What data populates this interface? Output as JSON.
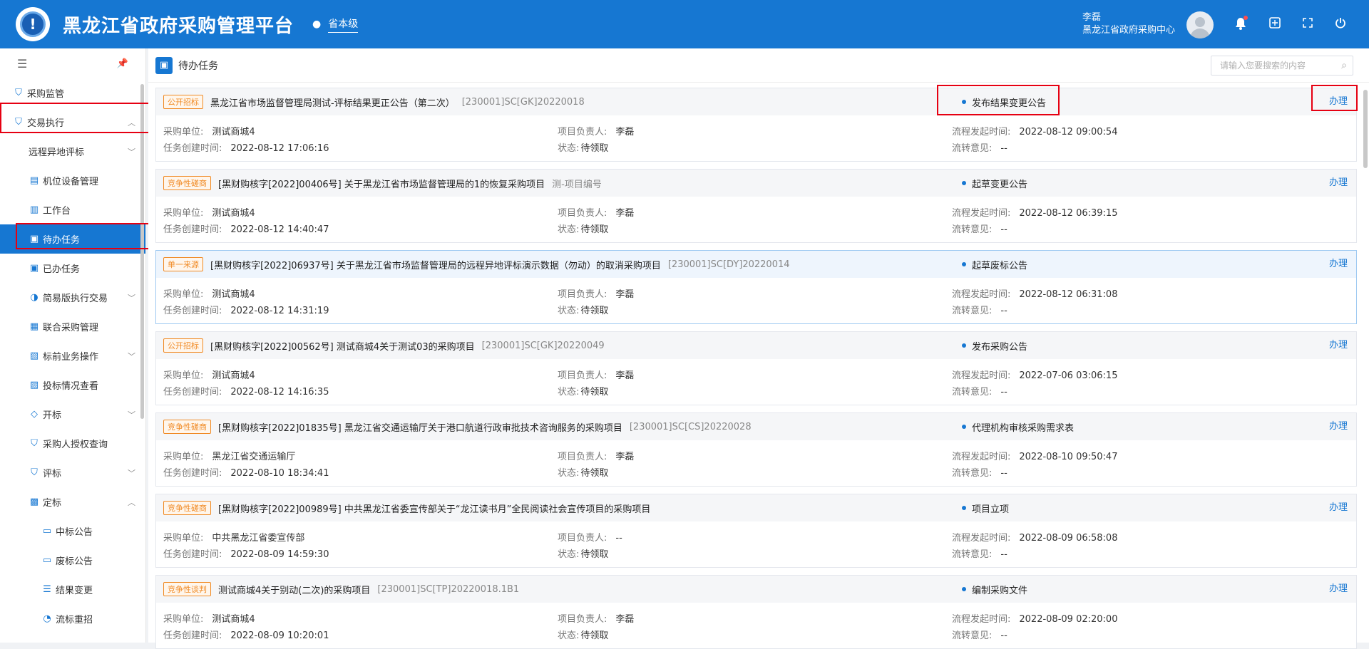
{
  "header": {
    "app_title": "黑龙江省政府采购管理平台",
    "location": "省本级",
    "user_name": "李磊",
    "user_org": "黑龙江省政府采购中心"
  },
  "sidebar": {
    "items": [
      {
        "label": "采购监管",
        "icon": "shield-icon"
      },
      {
        "label": "交易执行",
        "icon": "shield-icon"
      },
      {
        "label": "远程异地评标",
        "icon": ""
      },
      {
        "label": "机位设备管理",
        "icon": "device-icon"
      },
      {
        "label": "工作台",
        "icon": "workbench-icon"
      },
      {
        "label": "待办任务",
        "icon": "task-icon"
      },
      {
        "label": "已办任务",
        "icon": "task-done-icon"
      },
      {
        "label": "简易版执行交易",
        "icon": "exchange-icon"
      },
      {
        "label": "联合采购管理",
        "icon": "joint-icon"
      },
      {
        "label": "标前业务操作",
        "icon": "pre-bid-icon"
      },
      {
        "label": "投标情况查看",
        "icon": "bid-view-icon"
      },
      {
        "label": "开标",
        "icon": "open-bid-icon"
      },
      {
        "label": "采购人授权查询",
        "icon": "auth-icon"
      },
      {
        "label": "评标",
        "icon": "evaluate-icon"
      },
      {
        "label": "定标",
        "icon": "award-icon"
      },
      {
        "label": "中标公告",
        "icon": "notice-icon"
      },
      {
        "label": "废标公告",
        "icon": "notice-icon"
      },
      {
        "label": "结果变更",
        "icon": "change-icon"
      },
      {
        "label": "流标重招",
        "icon": "retender-icon"
      }
    ]
  },
  "main": {
    "title": "待办任务",
    "search_placeholder": "请输入您要搜索的内容",
    "labels": {
      "unit": "采购单位:",
      "created": "任务创建时间:",
      "owner": "项目负责人:",
      "state": "状态:",
      "flow_time": "流程发起时间:",
      "opinion": "流转意见:",
      "handle": "办理"
    },
    "cards": [
      {
        "tag": "公开招标",
        "title": "黑龙江省市场监督管理局测试-评标结果更正公告（第二次）",
        "code": "[230001]SC[GK]20220018",
        "status": "发布结果变更公告",
        "unit": "测试商城4",
        "created": "2022-08-12 17:06:16",
        "owner": "李磊",
        "state": "待领取",
        "flow_time": "2022-08-12 09:00:54",
        "opinion": "--"
      },
      {
        "tag": "竞争性磋商",
        "title": "[黑财购核字[2022]00406号] 关于黑龙江省市场监督管理局的1的恢复采购项目",
        "code": "测-项目编号",
        "status": "起草变更公告",
        "unit": "测试商城4",
        "created": "2022-08-12 14:40:47",
        "owner": "李磊",
        "state": "待领取",
        "flow_time": "2022-08-12 06:39:15",
        "opinion": "--"
      },
      {
        "tag": "单一来源",
        "title": "[黑财购核字[2022]06937号] 关于黑龙江省市场监督管理局的远程异地评标演示数据（勿动）的取消采购项目",
        "code": "[230001]SC[DY]20220014",
        "status": "起草废标公告",
        "unit": "测试商城4",
        "created": "2022-08-12 14:31:19",
        "owner": "李磊",
        "state": "待领取",
        "flow_time": "2022-08-12 06:31:08",
        "opinion": "--"
      },
      {
        "tag": "公开招标",
        "title": "[黑财购核字[2022]00562号] 测试商城4关于测试03的采购项目",
        "code": "[230001]SC[GK]20220049",
        "status": "发布采购公告",
        "unit": "测试商城4",
        "created": "2022-08-12 14:16:35",
        "owner": "李磊",
        "state": "待领取",
        "flow_time": "2022-07-06 03:06:15",
        "opinion": "--"
      },
      {
        "tag": "竞争性磋商",
        "title": "[黑财购核字[2022]01835号] 黑龙江省交通运输厅关于港口航道行政审批技术咨询服务的采购项目",
        "code": "[230001]SC[CS]20220028",
        "status": "代理机构审核采购需求表",
        "unit": "黑龙江省交通运输厅",
        "created": "2022-08-10 18:34:41",
        "owner": "李磊",
        "state": "待领取",
        "flow_time": "2022-08-10 09:50:47",
        "opinion": "--"
      },
      {
        "tag": "竞争性磋商",
        "title": "[黑财购核字[2022]00989号] 中共黑龙江省委宣传部关于“龙江读书月”全民阅读社会宣传项目的采购项目",
        "code": "",
        "status": "项目立项",
        "unit": "中共黑龙江省委宣传部",
        "created": "2022-08-09 14:59:30",
        "owner": "--",
        "state": "待领取",
        "flow_time": "2022-08-09 06:58:08",
        "opinion": "--"
      },
      {
        "tag": "竞争性谈判",
        "title": "测试商城4关于别动(二次)的采购项目",
        "code": "[230001]SC[TP]20220018.1B1",
        "status": "编制采购文件",
        "unit": "测试商城4",
        "created": "2022-08-09 10:20:01",
        "owner": "李磊",
        "state": "待领取",
        "flow_time": "2022-08-09 02:20:00",
        "opinion": "--"
      }
    ]
  }
}
